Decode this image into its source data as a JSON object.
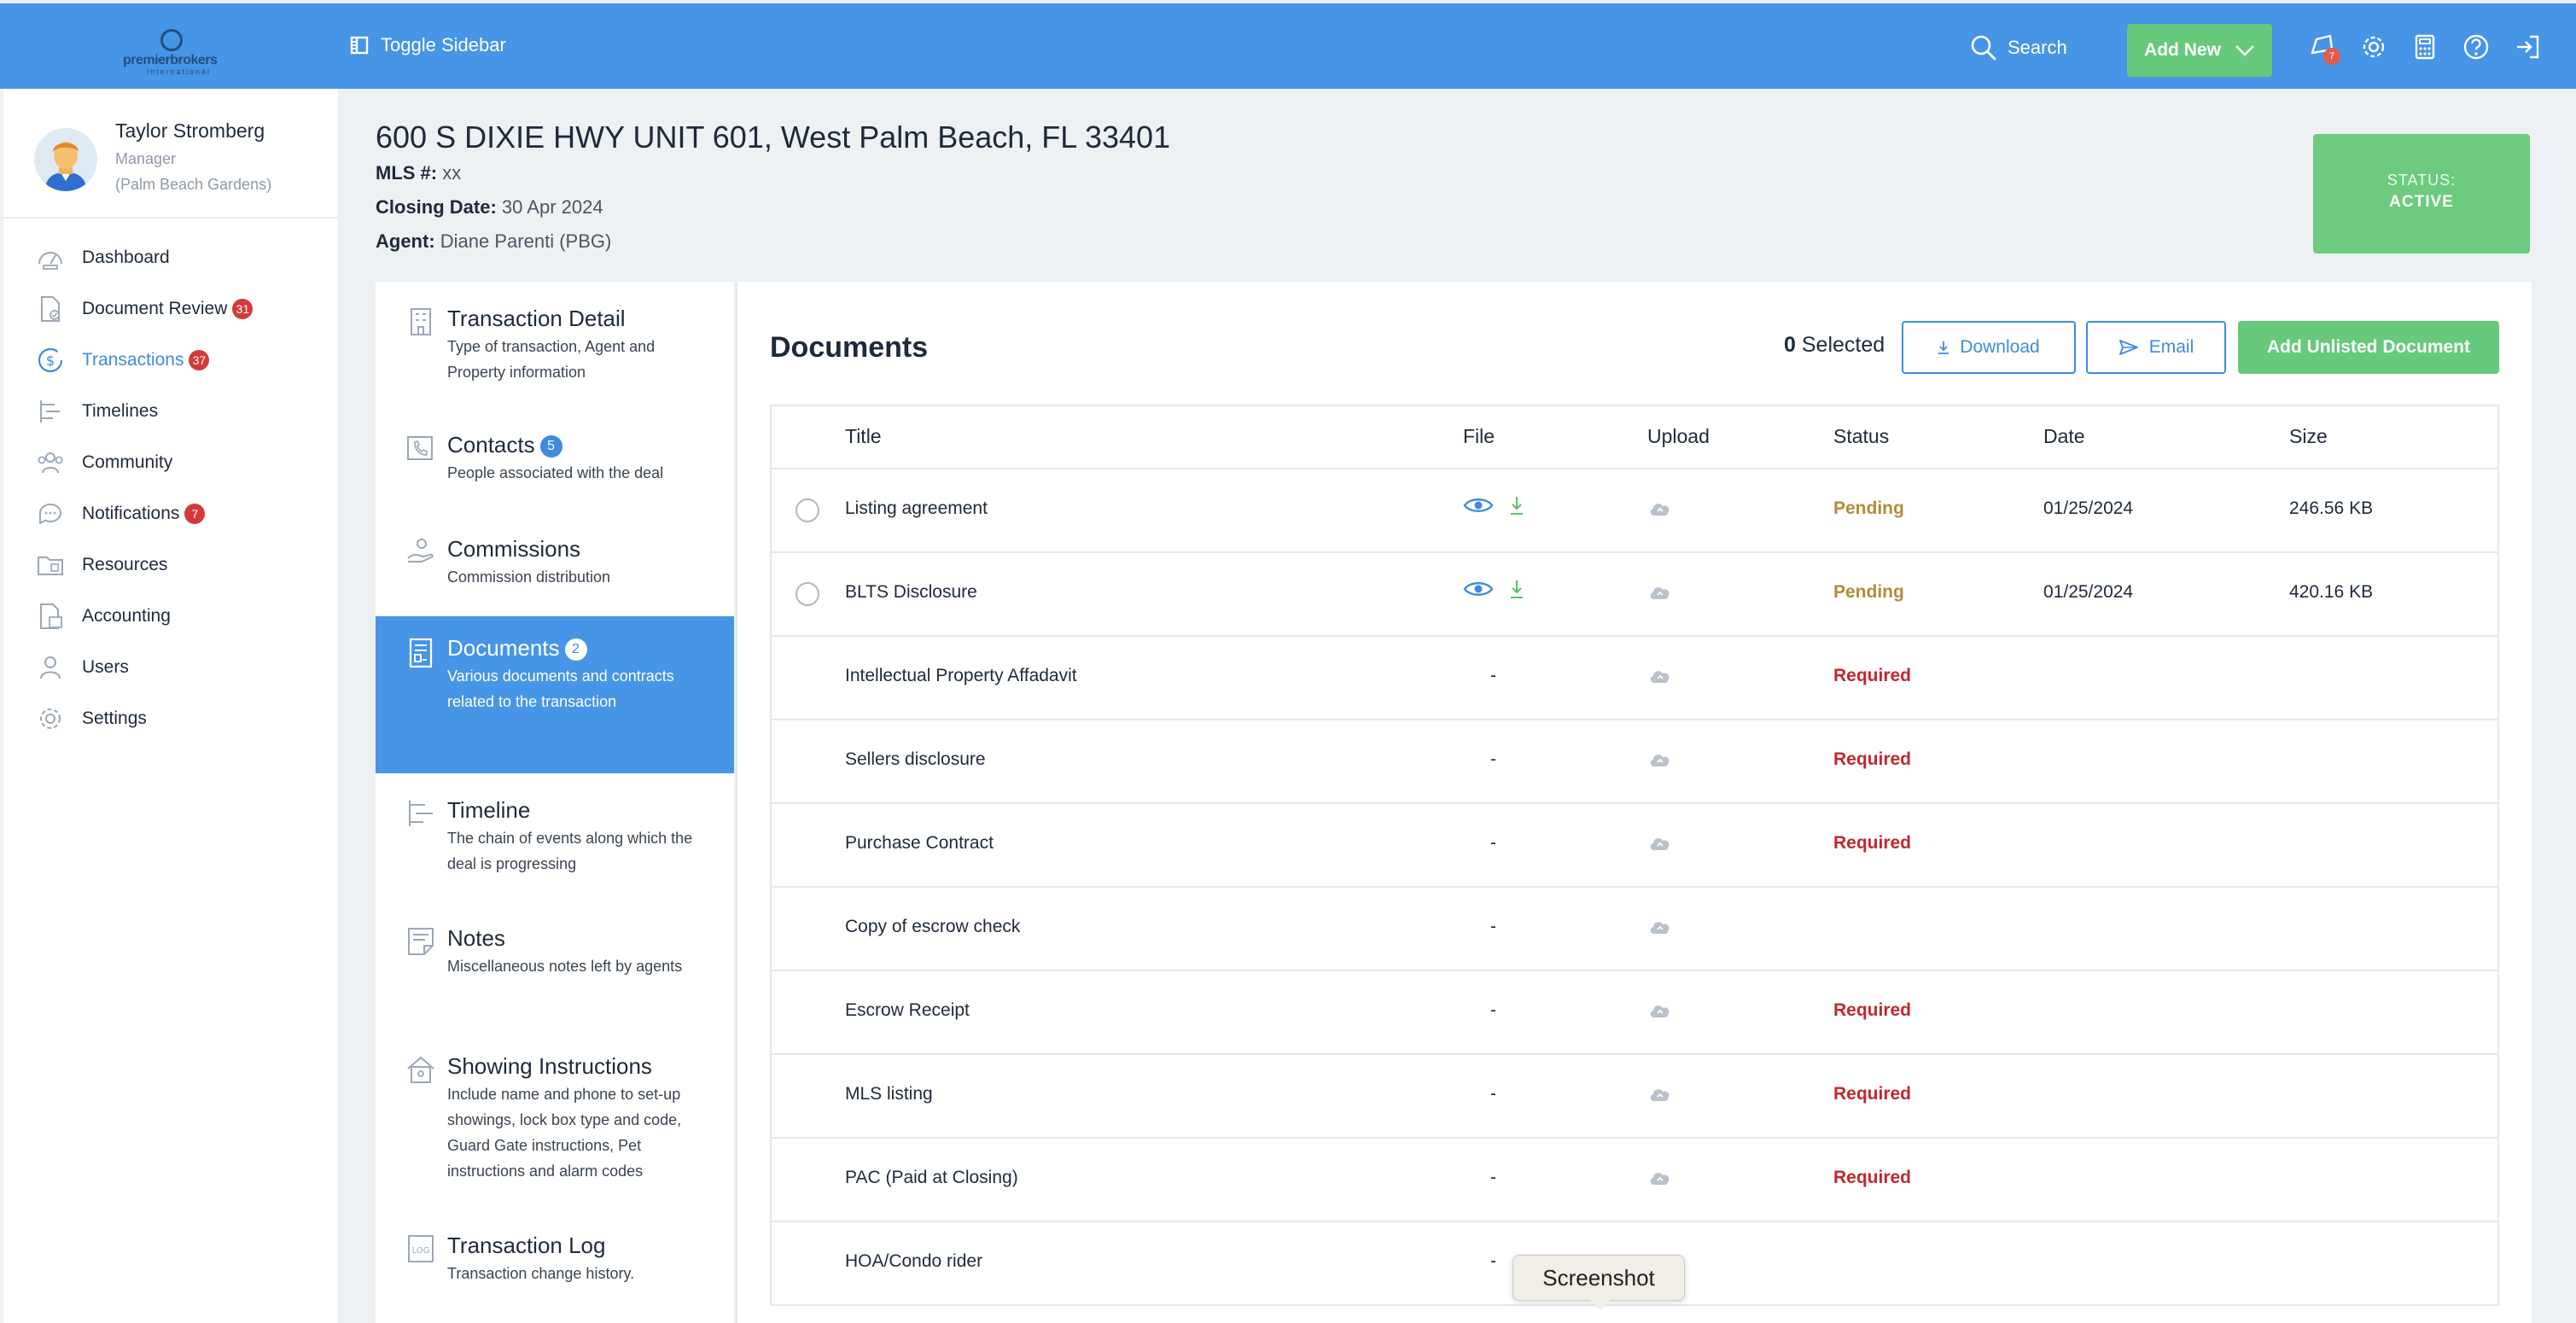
{
  "app": {
    "logo_text": "premierbrokers",
    "logo_sub": "international",
    "toggle_sidebar": "Toggle Sidebar",
    "search_label": "Search",
    "add_new_label": "Add New",
    "notification_count": "7",
    "accent": "#4695e6",
    "green": "#66c97c"
  },
  "user": {
    "name": "Taylor Stromberg",
    "role": "Manager",
    "office": "(Palm Beach Gardens)"
  },
  "nav": [
    {
      "label": "Dashboard",
      "icon": "dashboard-icon",
      "badge": ""
    },
    {
      "label": "Document Review",
      "icon": "document-review-icon",
      "badge": "31"
    },
    {
      "label": "Transactions",
      "icon": "transactions-icon",
      "badge": "37",
      "active": true
    },
    {
      "label": "Timelines",
      "icon": "timelines-icon",
      "badge": ""
    },
    {
      "label": "Community",
      "icon": "community-icon",
      "badge": ""
    },
    {
      "label": "Notifications",
      "icon": "notifications-icon",
      "badge": "7"
    },
    {
      "label": "Resources",
      "icon": "resources-icon",
      "badge": ""
    },
    {
      "label": "Accounting",
      "icon": "accounting-icon",
      "badge": ""
    },
    {
      "label": "Users",
      "icon": "users-icon",
      "badge": ""
    },
    {
      "label": "Settings",
      "icon": "settings-icon",
      "badge": ""
    }
  ],
  "transaction": {
    "address": "600 S DIXIE HWY UNIT 601, West Palm Beach, FL 33401",
    "mls_label": "MLS #:",
    "mls_value": "xx",
    "closing_label": "Closing Date:",
    "closing_value": "30 Apr 2024",
    "agent_label": "Agent:",
    "agent_value": "Diane Parenti (PBG)",
    "status_label": "STATUS:",
    "status_value": "ACTIVE"
  },
  "sections": [
    {
      "title": "Transaction Detail",
      "desc": "Type of transaction, Agent and Property information",
      "badge": ""
    },
    {
      "title": "Contacts",
      "desc": "People associated with the deal",
      "badge": "5"
    },
    {
      "title": "Commissions",
      "desc": "Commission distribution",
      "badge": ""
    },
    {
      "title": "Documents",
      "desc": "Various documents and contracts related to the transaction",
      "badge": "2",
      "active": true
    },
    {
      "title": "Timeline",
      "desc": "The chain of events along which the deal is progressing",
      "badge": ""
    },
    {
      "title": "Notes",
      "desc": "Miscellaneous notes left by agents",
      "badge": ""
    },
    {
      "title": "Showing Instructions",
      "desc": "Include name and phone to set-up showings, lock box type and code, Guard Gate instructions, Pet instructions and alarm codes",
      "badge": ""
    },
    {
      "title": "Transaction Log",
      "desc": "Transaction change history.",
      "badge": ""
    }
  ],
  "documents": {
    "title": "Documents",
    "selected_count": "0",
    "selected_label": "Selected",
    "download_label": "Download",
    "email_label": "Email",
    "add_unlisted_label": "Add Unlisted Document",
    "columns": [
      "Title",
      "File",
      "Upload",
      "Status",
      "Date",
      "Size"
    ],
    "rows": [
      {
        "title": "Listing agreement",
        "file": "",
        "status": "Pending",
        "date": "01/25/2024",
        "size": "246.56 KB"
      },
      {
        "title": "BLTS Disclosure",
        "file": "",
        "status": "Pending",
        "date": "01/25/2024",
        "size": "420.16 KB"
      },
      {
        "title": "Intellectual Property Affadavit",
        "file": "-",
        "status": "Required",
        "date": "",
        "size": ""
      },
      {
        "title": "Sellers disclosure",
        "file": "-",
        "status": "Required",
        "date": "",
        "size": ""
      },
      {
        "title": "Purchase Contract",
        "file": "-",
        "status": "Required",
        "date": "",
        "size": ""
      },
      {
        "title": "Copy of escrow check",
        "file": "-",
        "status": "",
        "date": "",
        "size": ""
      },
      {
        "title": "Escrow Receipt",
        "file": "-",
        "status": "Required",
        "date": "",
        "size": ""
      },
      {
        "title": "MLS listing",
        "file": "-",
        "status": "Required",
        "date": "",
        "size": ""
      },
      {
        "title": "PAC (Paid at Closing)",
        "file": "-",
        "status": "Required",
        "date": "",
        "size": ""
      },
      {
        "title": "HOA/Condo rider",
        "file": "-",
        "status": "",
        "date": "",
        "size": ""
      }
    ]
  },
  "tooltip": "Screenshot"
}
